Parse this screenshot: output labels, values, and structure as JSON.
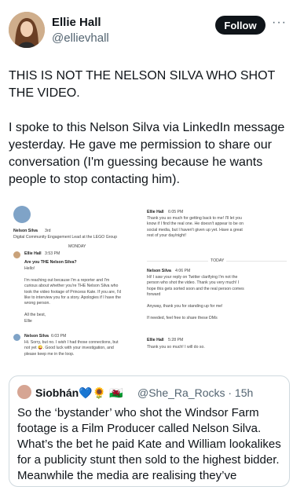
{
  "author": {
    "name": "Ellie Hall",
    "handle": "@ellievhall"
  },
  "follow_label": "Follow",
  "more_label": "···",
  "tweet_text": "THIS IS NOT THE NELSON SILVA WHO SHOT THE VIDEO.\n\nI spoke to this Nelson Silva via LinkedIn message yesterday. He gave me permission to share our conversation (I'm guessing because he wants people to stop contacting him).",
  "screenshot": {
    "profile_name": "Nelson Silva",
    "profile_degree": "3rd",
    "profile_title": "Digital Community Engagement Lead at the LEGO Group",
    "day_monday": "MONDAY",
    "msg1_author": "Ellie Hall",
    "msg1_time": "3:53 PM",
    "msg1_subject": "Are you THE Nelson Silva?",
    "msg1_lines": [
      "Hello!",
      "",
      "I'm reaching out because I'm a reporter and I'm",
      "curious about whether you're THE Nelson Silva who",
      "took the video footage of Princess Kate. If you are, I'd",
      "like to interview you for a story. Apologies if I have the",
      "wrong person.",
      "",
      "All the best,",
      "Ellie"
    ],
    "msg2_author": "Nelson Silva",
    "msg2_time": "6:03 PM",
    "msg2_lines": [
      "Hi. Sorry, but no. I wish I had those connections, but",
      "not yet 😜. Good luck with your investigation, and",
      "please keep me in the loop."
    ],
    "msg3_author": "Ellie Hall",
    "msg3_time": "6:05 PM",
    "msg3_lines": [
      "Thank you so much for getting back to me! I'll let you",
      "know if I find the real one. He doesn't appear to be on",
      "social media, but I haven't given up yet. Have a great",
      "rest of your day/night!"
    ],
    "day_today": "TODAY",
    "msg4_author": "Nelson Silva",
    "msg4_time": "4:06 PM",
    "msg4_lines": [
      "Hi! I saw your reply on Twitter clarifying I'm not the",
      "person who shot the video. Thank you very much! I",
      "hope this gets sorted soon and the real person comes",
      "forward",
      "",
      "Anyway, thank you for standing up for me!",
      "",
      "If needed, feel free to share these DMs"
    ],
    "msg5_author": "Ellie Hall",
    "msg5_time": "5:28 PM",
    "msg5_lines": [
      "Thank you so much! I will do so."
    ]
  },
  "quote": {
    "name": "Siobhán💙🌻 🏴󠁧󠁢󠁷󠁬󠁳󠁿",
    "handle": "@She_Ra_Rocks · 15h",
    "text": "So the ‘bystander’ who shot the Windsor Farm footage is a Film Producer called Nelson Silva. What’s the bet he paid Kate and William lookalikes for a publicity stunt then sold to the highest bidder. Meanwhile the media are realising they’ve"
  }
}
